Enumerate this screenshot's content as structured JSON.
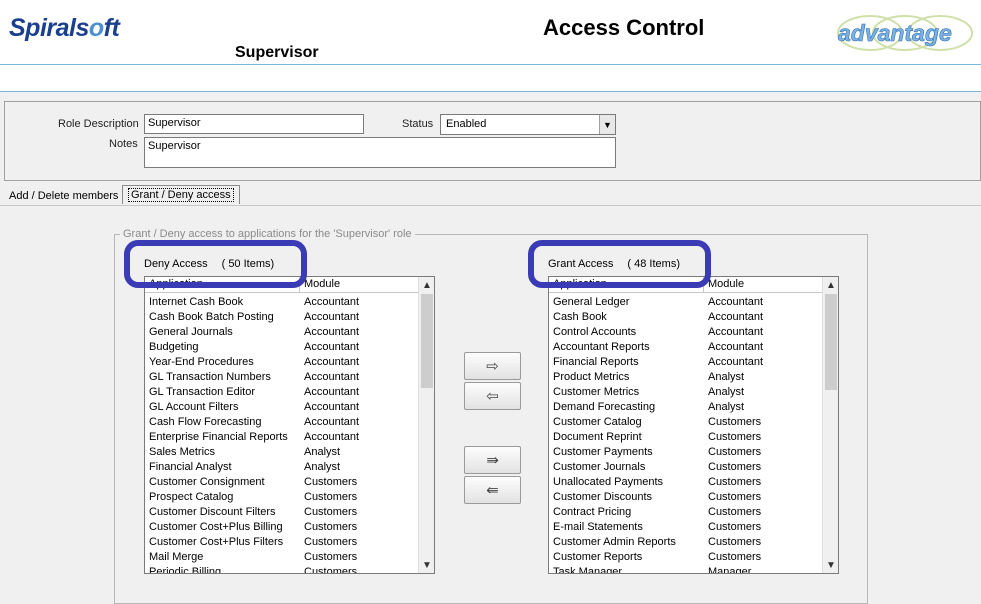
{
  "header": {
    "logo_text_a": "Spirals",
    "logo_text_b": "ft",
    "logo_swirl": "o",
    "page_title": "Access Control",
    "role_heading": "Supervisor",
    "product_logo": "advantage"
  },
  "role_form": {
    "description_label": "Role Description",
    "description_value": "Supervisor",
    "status_label": "Status",
    "status_value": "Enabled",
    "notes_label": "Notes",
    "notes_value": "Supervisor"
  },
  "tabs": [
    {
      "label": "Add / Delete members"
    },
    {
      "label": "Grant / Deny access"
    }
  ],
  "group_legend": "Grant / Deny access to applications for the 'Supervisor' role",
  "deny": {
    "title": "Deny Access",
    "count": "( 50 Items)",
    "col_application": "Application",
    "col_module": "Module",
    "rows": [
      [
        "Internet Cash Book",
        "Accountant"
      ],
      [
        "Cash Book Batch Posting",
        "Accountant"
      ],
      [
        "General Journals",
        "Accountant"
      ],
      [
        "Budgeting",
        "Accountant"
      ],
      [
        "Year-End Procedures",
        "Accountant"
      ],
      [
        "GL Transaction Numbers",
        "Accountant"
      ],
      [
        "GL Transaction Editor",
        "Accountant"
      ],
      [
        "GL Account Filters",
        "Accountant"
      ],
      [
        "Cash Flow Forecasting",
        "Accountant"
      ],
      [
        "Enterprise Financial Reports",
        "Accountant"
      ],
      [
        "Sales Metrics",
        "Analyst"
      ],
      [
        "Financial Analyst",
        "Analyst"
      ],
      [
        "Customer Consignment",
        "Customers"
      ],
      [
        "Prospect Catalog",
        "Customers"
      ],
      [
        "Customer Discount Filters",
        "Customers"
      ],
      [
        "Customer Cost+Plus Billing",
        "Customers"
      ],
      [
        "Customer Cost+Plus Filters",
        "Customers"
      ],
      [
        "Mail Merge",
        "Customers"
      ],
      [
        "Periodic Billing",
        "Customers"
      ]
    ]
  },
  "grant": {
    "title": "Grant Access",
    "count": "( 48 Items)",
    "col_application": "Application",
    "col_module": "Module",
    "rows": [
      [
        "General Ledger",
        "Accountant"
      ],
      [
        "Cash Book",
        "Accountant"
      ],
      [
        "Control Accounts",
        "Accountant"
      ],
      [
        "Accountant Reports",
        "Accountant"
      ],
      [
        "Financial Reports",
        "Accountant"
      ],
      [
        "Product Metrics",
        "Analyst"
      ],
      [
        "Customer Metrics",
        "Analyst"
      ],
      [
        "Demand Forecasting",
        "Analyst"
      ],
      [
        "Customer Catalog",
        "Customers"
      ],
      [
        "Document Reprint",
        "Customers"
      ],
      [
        "Customer Payments",
        "Customers"
      ],
      [
        "Customer Journals",
        "Customers"
      ],
      [
        "Unallocated Payments",
        "Customers"
      ],
      [
        "Customer Discounts",
        "Customers"
      ],
      [
        "Contract Pricing",
        "Customers"
      ],
      [
        "E-mail Statements",
        "Customers"
      ],
      [
        "Customer Admin Reports",
        "Customers"
      ],
      [
        "Customer Reports",
        "Customers"
      ],
      [
        "Task Manager",
        "Manager"
      ]
    ]
  },
  "buttons": {
    "move_right": "⇨",
    "move_left": "⇦",
    "move_all_right": "⇛",
    "move_all_left": "⇚"
  },
  "colors": {
    "brand": "#1b3f8f",
    "highlight": "#3b3bb5",
    "divider": "#7ab8d8"
  },
  "icons": {
    "scroll_up": "up-arrow-icon",
    "scroll_down": "down-arrow-icon",
    "select_dropdown": "chevron-down-icon"
  }
}
